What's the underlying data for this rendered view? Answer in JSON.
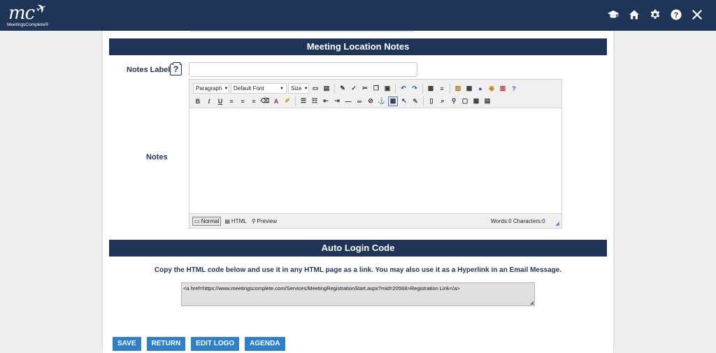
{
  "header": {
    "logo_text": "mc",
    "logo_subtext": "MeetingsComplete®",
    "icons": [
      "graduation-cap-icon",
      "home-icon",
      "gear-icon",
      "help-icon",
      "close-icon"
    ]
  },
  "location_section": {
    "title": "Meeting Location Notes",
    "notes_label_label": "Notes Label",
    "help_icon_text": "?",
    "notes_label_value": "",
    "notes_label": "Notes"
  },
  "editor": {
    "paragraph": "Paragraph",
    "font": "Default Font",
    "size": "Size",
    "modes": [
      "Normal",
      "HTML",
      "Preview"
    ],
    "active_mode": "Normal",
    "counter": "Words:0 Characters:0",
    "content": ""
  },
  "auto_login": {
    "title": "Auto Login Code",
    "instructions": "Copy the HTML code below and use it in any HTML page as a link. You may also use it as a Hyperlink in an Email Message.",
    "code": "<a href=https://www.meetingscomplete.com/Services/MeetingRegistrationStart.aspx?mid=20568>Registration Link</a>"
  },
  "actions": {
    "save": "SAVE",
    "return": "RETURN",
    "edit_logo": "EDIT LOGO",
    "agenda": "AGENDA"
  },
  "colors": {
    "navy": "#1e3557",
    "button_blue": "#2f7fc9",
    "page_bg": "#eeeeee"
  }
}
